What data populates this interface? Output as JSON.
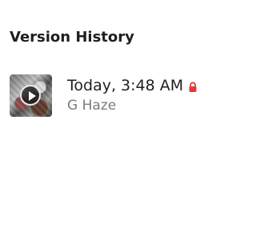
{
  "page": {
    "title": "Version History"
  },
  "version_history": {
    "items": [
      {
        "timestamp": "Today, 3:48 AM",
        "author": "G Haze",
        "locked": true,
        "lock_icon": "lock-icon",
        "thumbnail_icon": "play-icon"
      }
    ]
  },
  "colors": {
    "title": "#1f1f1f",
    "secondary_text": "#7b7b7b",
    "lock": "#e53935"
  }
}
